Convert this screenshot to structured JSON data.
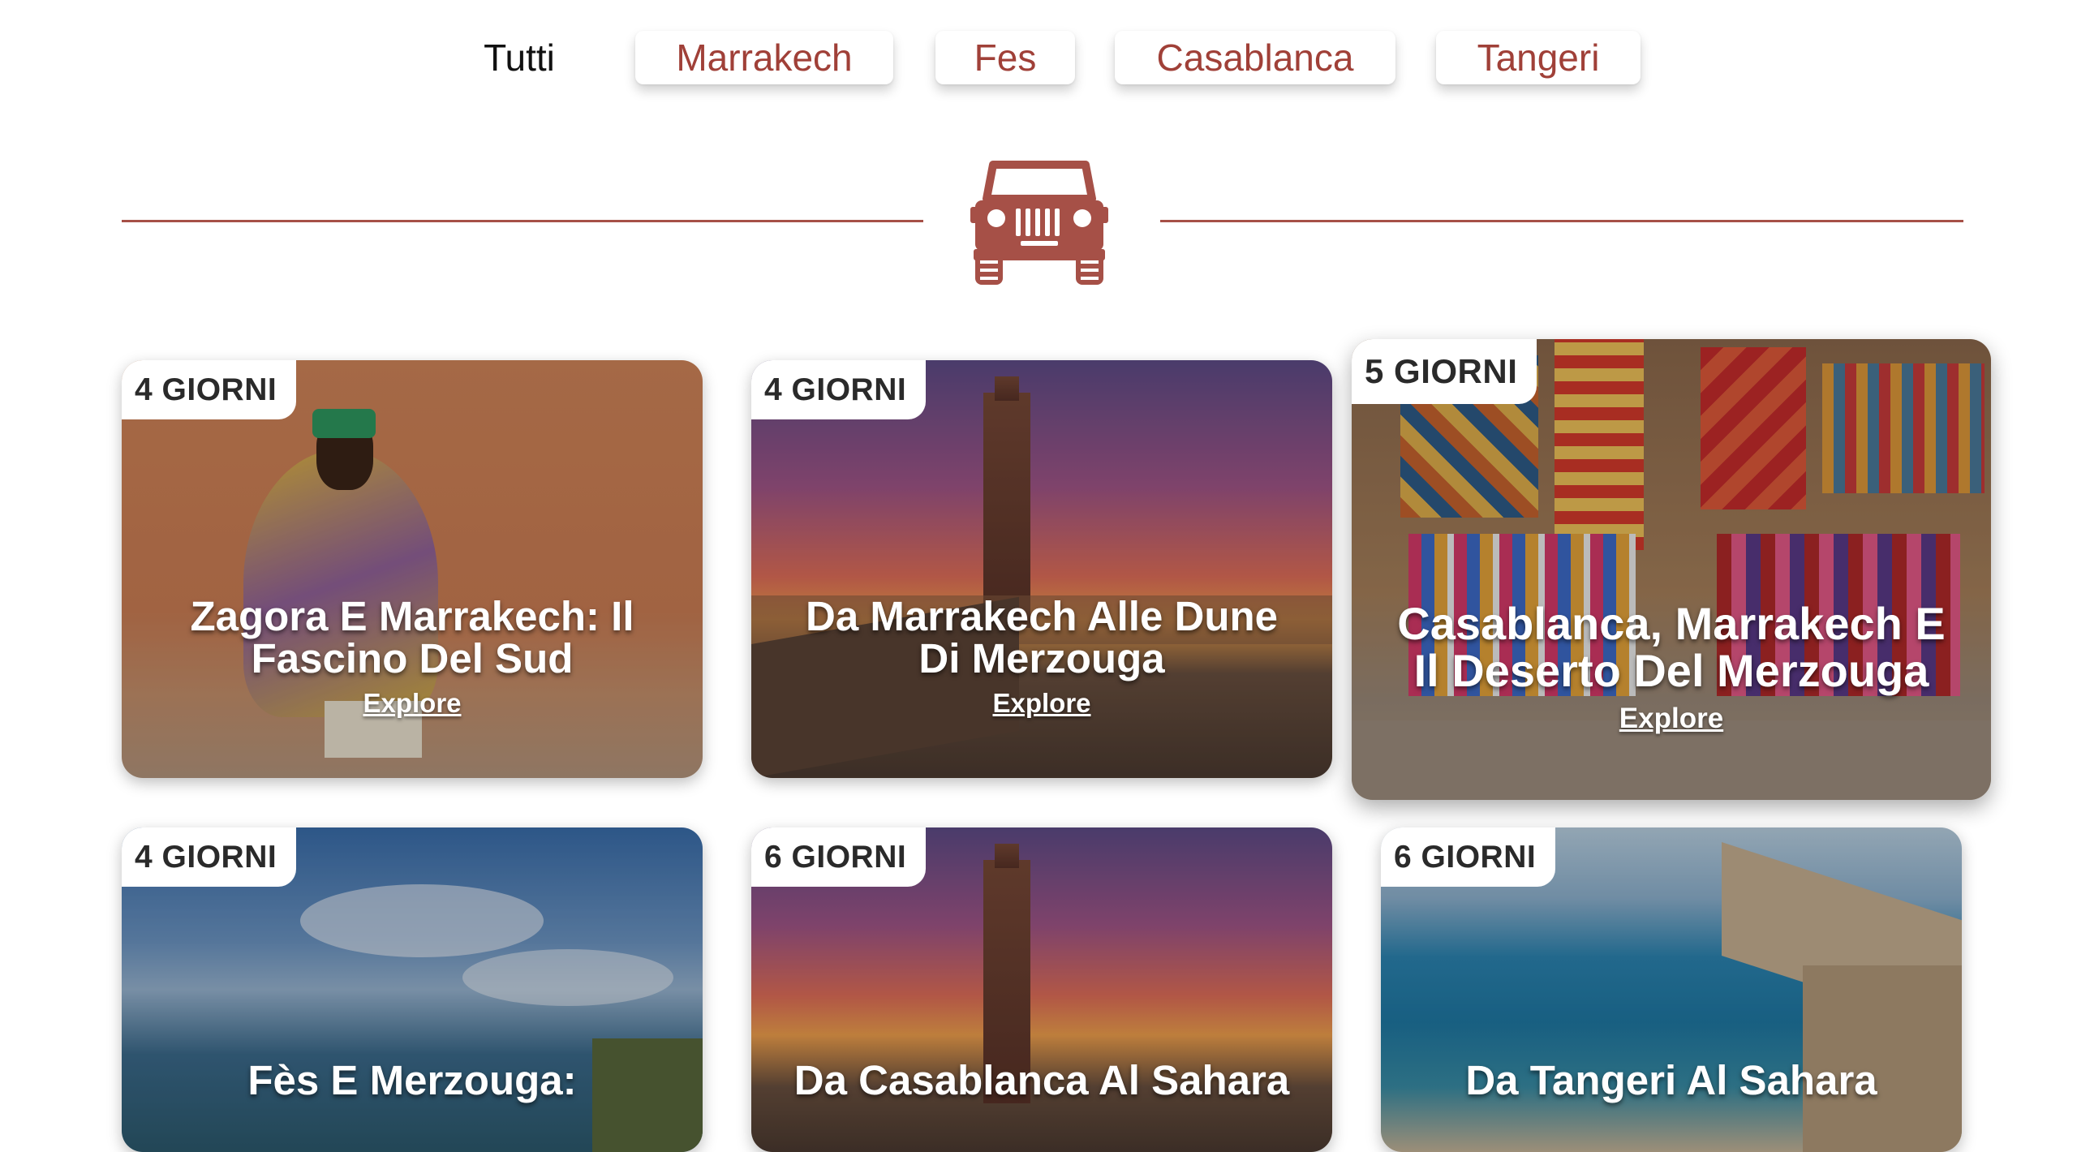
{
  "filters": [
    {
      "label": "Tutti",
      "active": true
    },
    {
      "label": "Marrakech",
      "active": false
    },
    {
      "label": "Fes",
      "active": false
    },
    {
      "label": "Casablanca",
      "active": false
    },
    {
      "label": "Tangeri",
      "active": false
    }
  ],
  "divider_icon": "jeep-icon",
  "accent_color": "#a65047",
  "tours": [
    {
      "duration": "4 GIORNI",
      "title": "Zagora E Marrakech: Il Fascino Del Sud",
      "cta": "Explore"
    },
    {
      "duration": "4 GIORNI",
      "title": "Da Marrakech Alle Dune Di Merzouga",
      "cta": "Explore"
    },
    {
      "duration": "5 GIORNI",
      "title": "Casablanca, Marrakech E Il Deserto Del Merzouga",
      "cta": "Explore"
    },
    {
      "duration": "4 GIORNI",
      "title": "Fès E Merzouga:",
      "cta": ""
    },
    {
      "duration": "6 GIORNI",
      "title": "Da Casablanca Al Sahara",
      "cta": ""
    },
    {
      "duration": "6 GIORNI",
      "title": "Da Tangeri Al Sahara",
      "cta": ""
    }
  ]
}
